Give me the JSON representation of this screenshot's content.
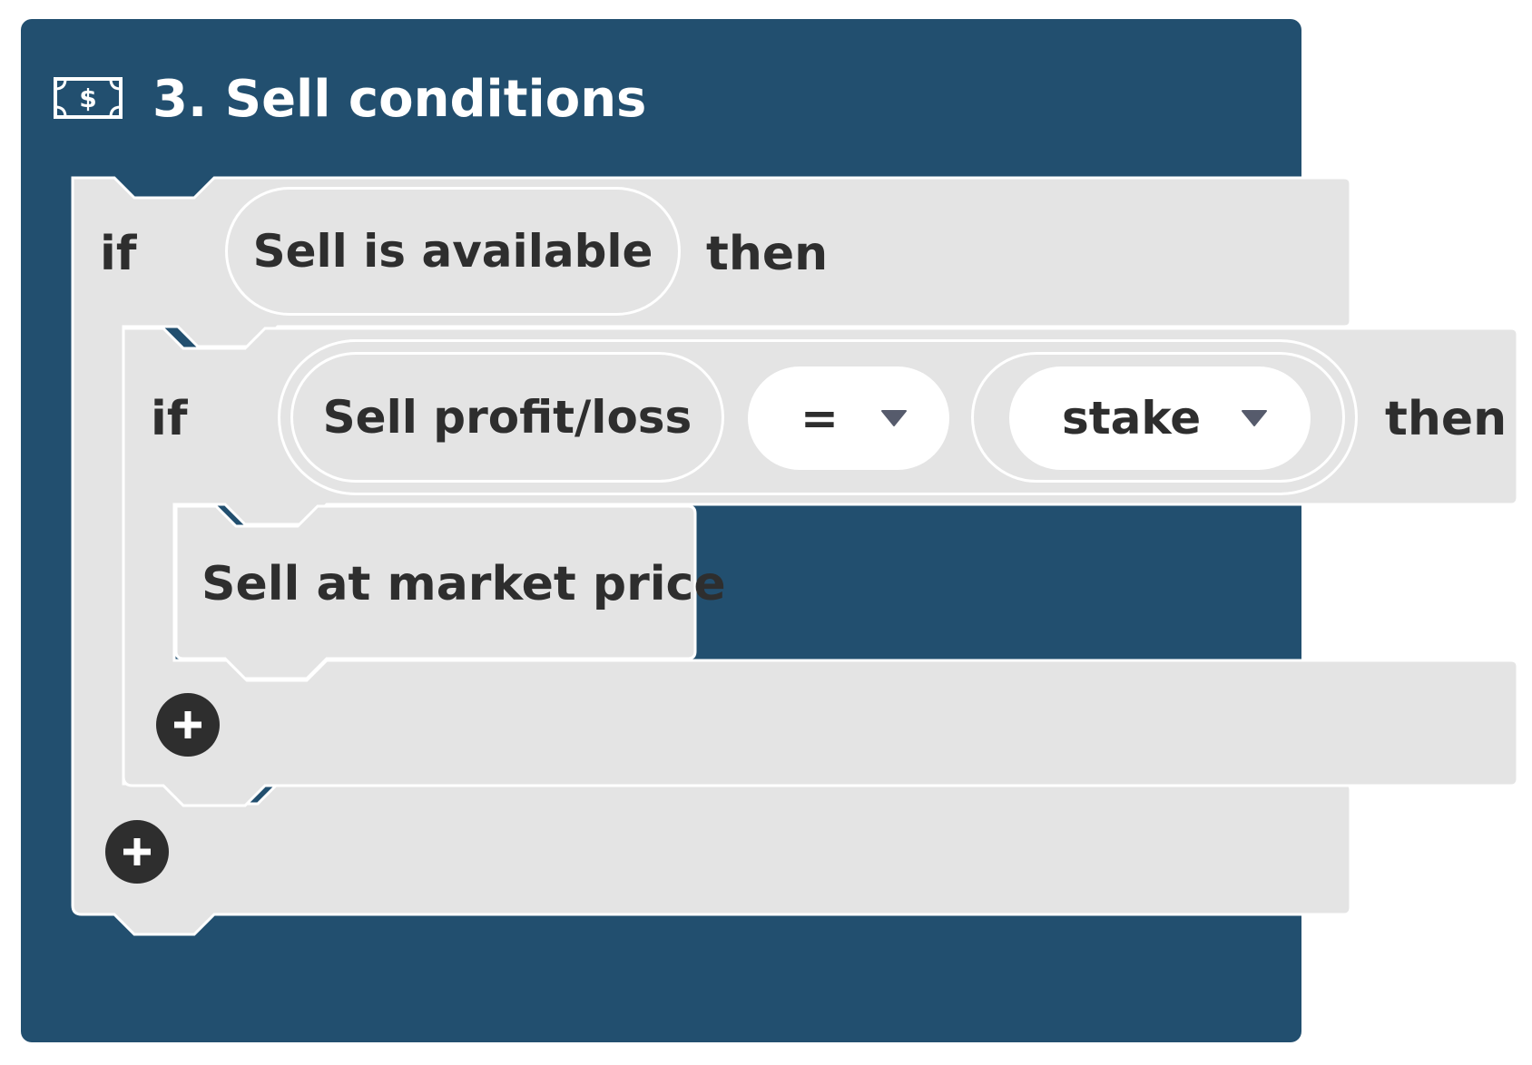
{
  "block": {
    "title": "3. Sell conditions",
    "icon": "money-bill-icon",
    "color": "#224f6f"
  },
  "outer_if": {
    "if_label": "if",
    "condition": "Sell is available",
    "then_label": "then"
  },
  "inner_if": {
    "if_label": "if",
    "left_operand": "Sell profit/loss",
    "operator": "=",
    "right_operand": "stake",
    "then_label": "then"
  },
  "action": {
    "label": "Sell at market price"
  },
  "colors": {
    "block_bg": "#e4e4e4",
    "text": "#2e2e2e",
    "caret": "#565b6c"
  }
}
